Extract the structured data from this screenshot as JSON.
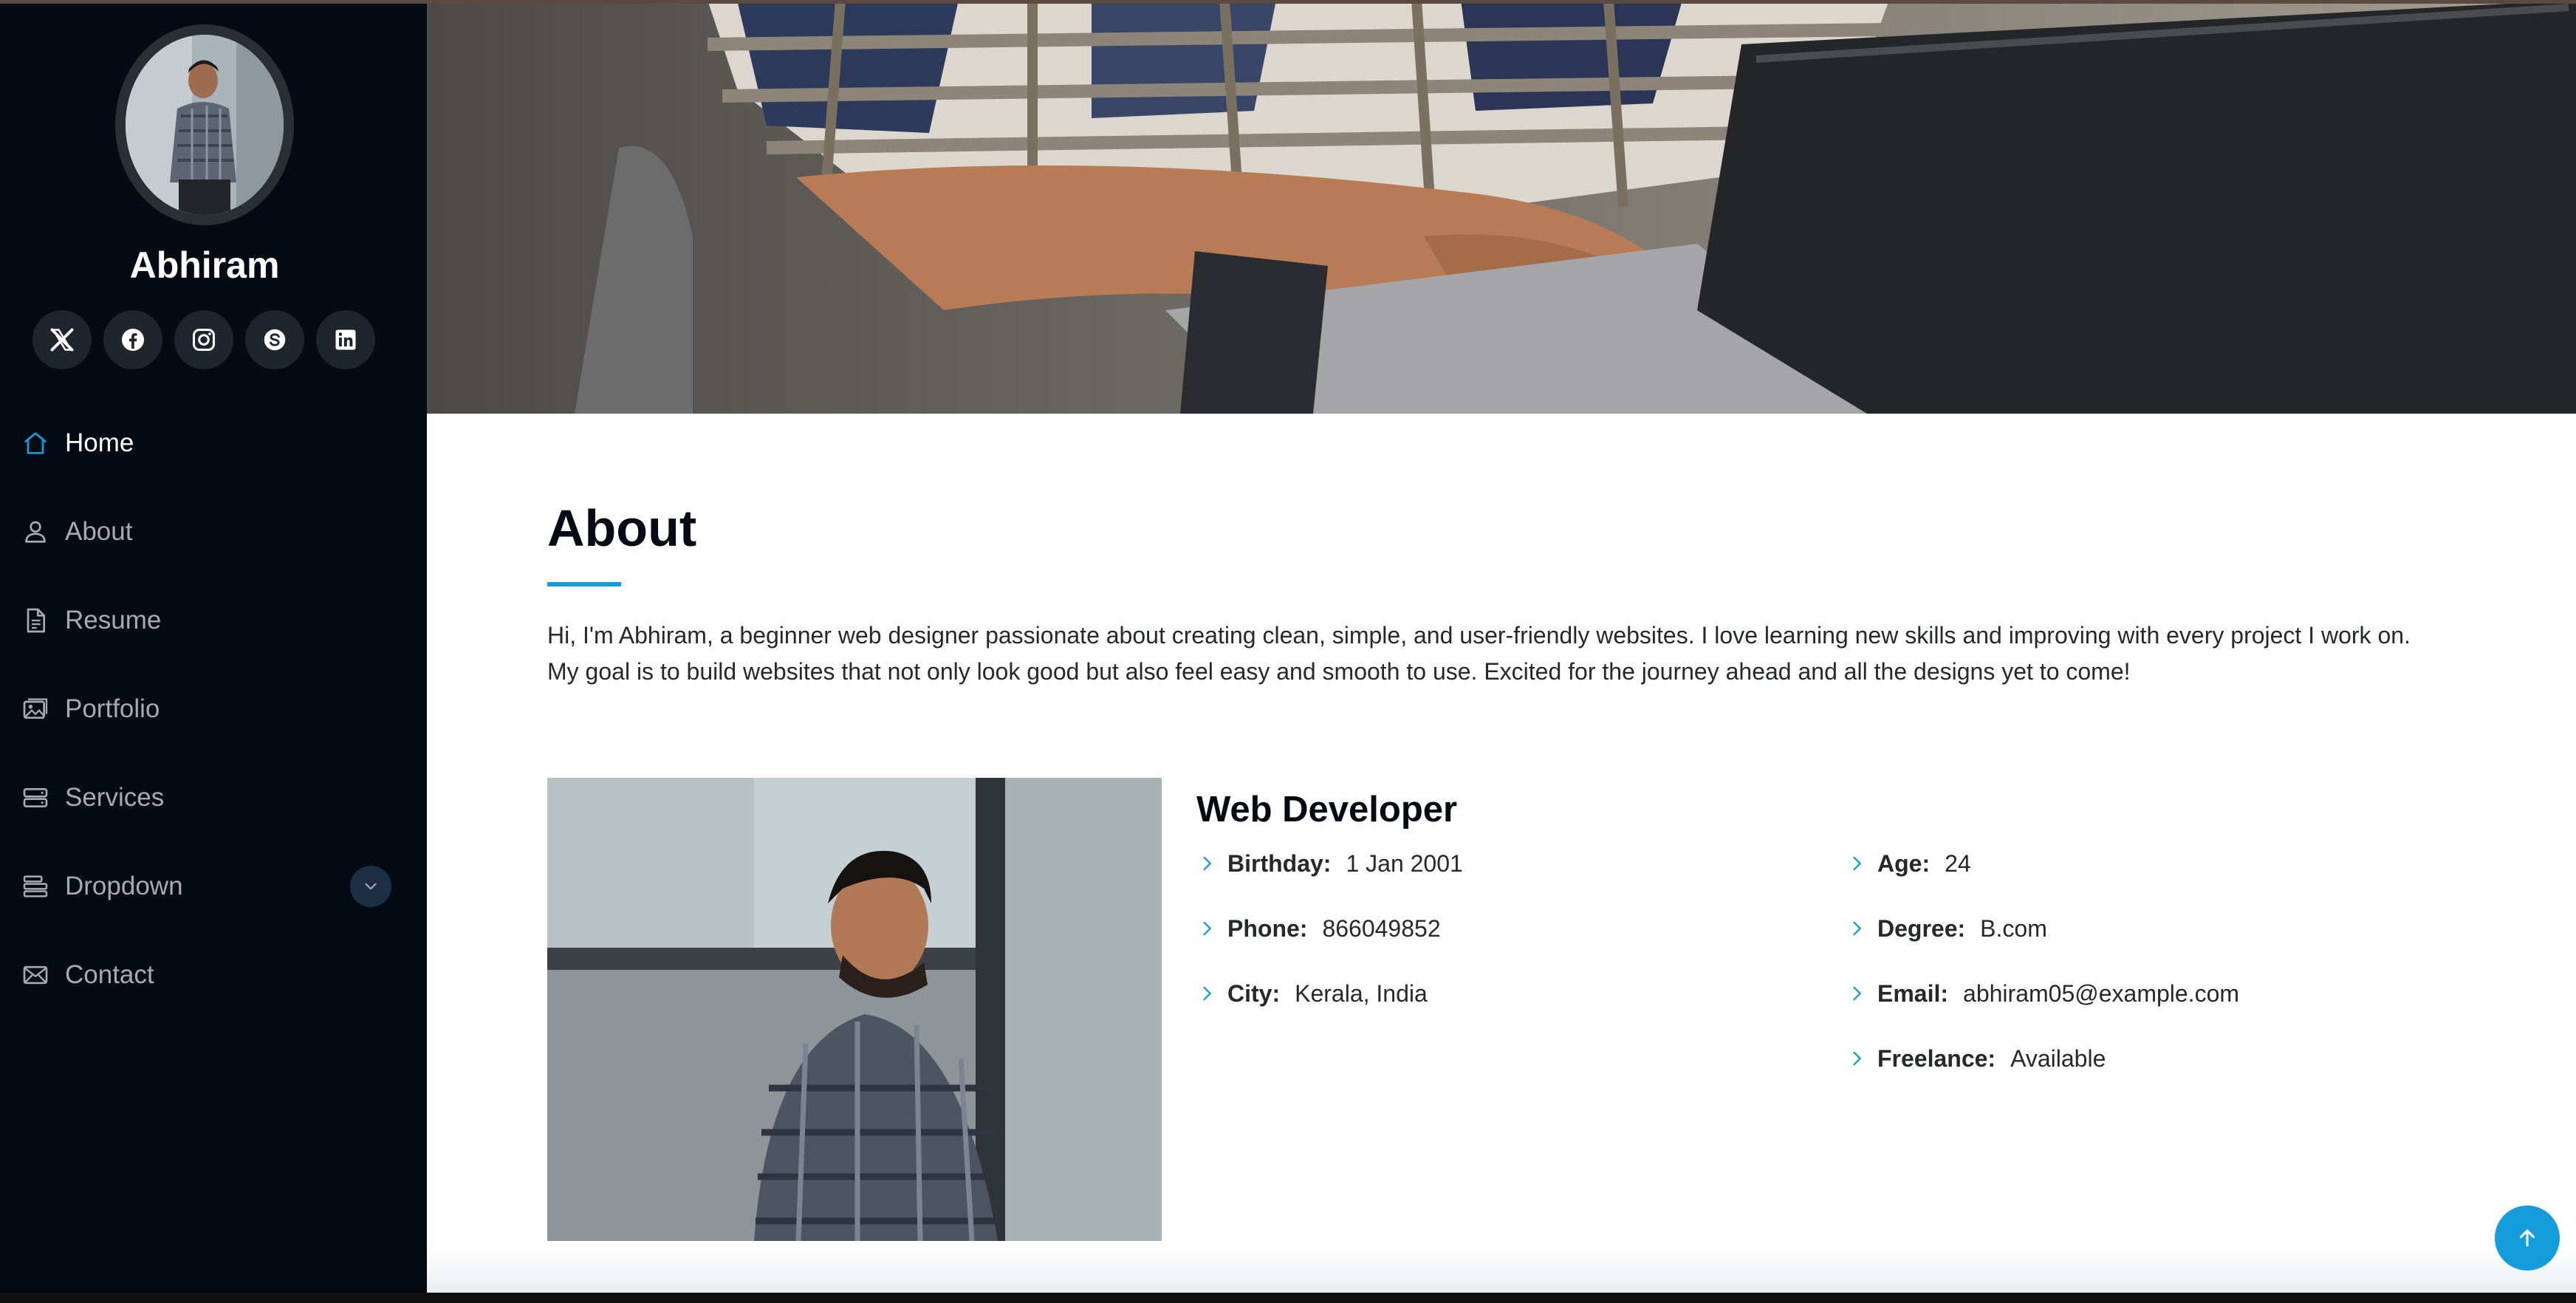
{
  "profile": {
    "name": "Abhiram"
  },
  "socials": [
    {
      "icon": "x-twitter-icon"
    },
    {
      "icon": "facebook-icon"
    },
    {
      "icon": "instagram-icon"
    },
    {
      "icon": "skype-icon"
    },
    {
      "icon": "linkedin-icon"
    }
  ],
  "nav": {
    "items": [
      {
        "label": "Home",
        "icon": "house-icon",
        "active": true
      },
      {
        "label": "About",
        "icon": "person-icon"
      },
      {
        "label": "Resume",
        "icon": "file-text-icon"
      },
      {
        "label": "Portfolio",
        "icon": "images-icon"
      },
      {
        "label": "Services",
        "icon": "hdd-stack-icon"
      },
      {
        "label": "Dropdown",
        "icon": "menu-list-icon",
        "has_submenu": true
      },
      {
        "label": "Contact",
        "icon": "envelope-icon"
      }
    ]
  },
  "about": {
    "title": "About",
    "text": "Hi, I'm Abhiram, a beginner web designer passionate about creating clean, simple, and user-friendly websites. I love learning new skills and improving with every project I work on. My goal is to build websites that not only look good but also feel easy and smooth to use. Excited for the journey ahead and all the designs yet to come!",
    "role": "Web Developer",
    "info_left": [
      {
        "key": "Birthday:",
        "value": "1 Jan 2001"
      },
      {
        "key": "Phone:",
        "value": "866049852"
      },
      {
        "key": "City:",
        "value": "Kerala, India"
      }
    ],
    "info_right": [
      {
        "key": "Age:",
        "value": "24"
      },
      {
        "key": "Degree:",
        "value": "B.com"
      },
      {
        "key": "Email:",
        "value": "abhiram05@example.com"
      },
      {
        "key": "Freelance:",
        "value": "Available"
      }
    ]
  },
  "colors": {
    "sidebar_bg": "#040b14",
    "accent": "#149ddd",
    "heading": "#040b14",
    "nav_text": "#a8a9b4"
  }
}
